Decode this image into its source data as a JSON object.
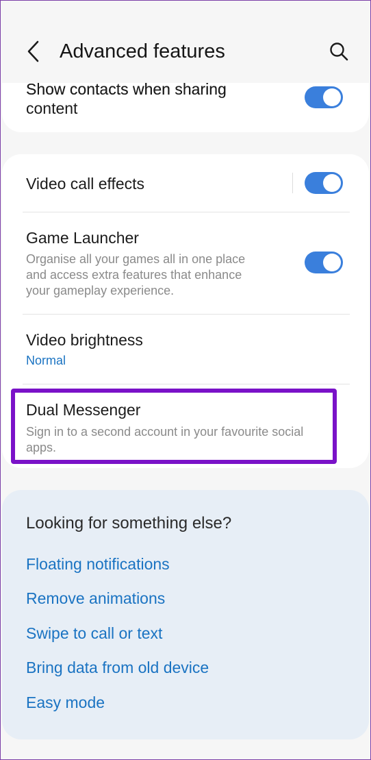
{
  "header": {
    "title": "Advanced features",
    "back_icon": "chevron-left-icon",
    "search_icon": "search-icon"
  },
  "top_item": {
    "title_line1": "Show contacts when sharing",
    "title_line2": "content",
    "enabled": true
  },
  "items": [
    {
      "title": "Video call effects",
      "enabled": true
    },
    {
      "title": "Game Launcher",
      "sub_line1": "Organise all your games all in one place",
      "sub_line2": "and access extra features that enhance",
      "sub_line3": "your gameplay experience.",
      "enabled": true
    },
    {
      "title": "Video brightness",
      "value": "Normal"
    },
    {
      "title": "Dual Messenger",
      "sub_line1": "Sign in to a second account in your favourite social",
      "sub_line2": "apps."
    }
  ],
  "suggestions": {
    "heading": "Looking for something else?",
    "links": [
      "Floating notifications",
      "Remove animations",
      "Swipe to call or text",
      "Bring data from old device",
      "Easy mode"
    ]
  },
  "colors": {
    "accent": "#1a73c2",
    "toggle_on": "#3a7fdc",
    "highlight": "#7a12c8",
    "suggest_bg": "#e7eef6"
  }
}
